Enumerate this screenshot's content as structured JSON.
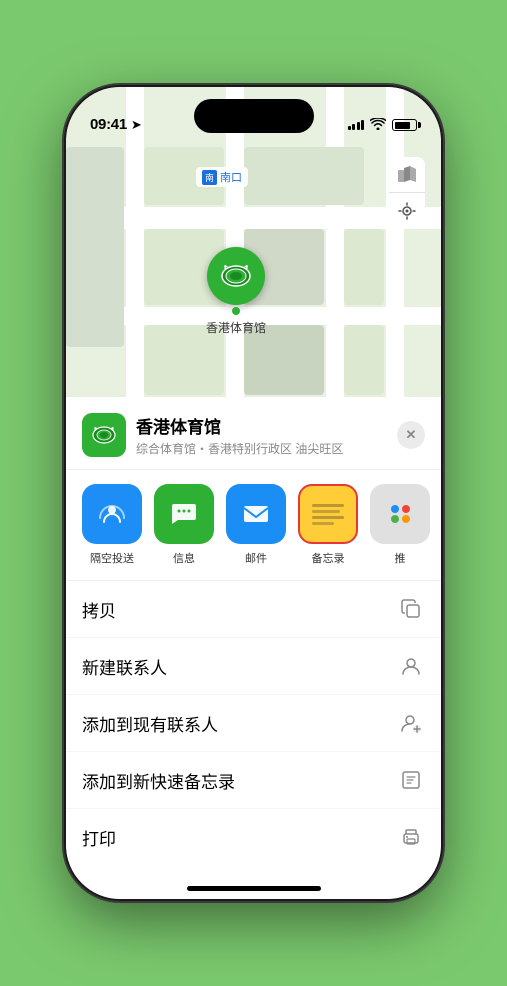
{
  "statusBar": {
    "time": "09:41",
    "location": true
  },
  "map": {
    "label": "南口",
    "controls": {
      "map_icon": "🗺",
      "location_icon": "↗"
    }
  },
  "venueCard": {
    "name": "香港体育馆",
    "subtitle": "综合体育馆・香港特别行政区 油尖旺区",
    "close_label": "✕"
  },
  "shareRow": {
    "items": [
      {
        "id": "airdrop",
        "label": "隔空投送",
        "icon": "📡"
      },
      {
        "id": "messages",
        "label": "信息",
        "icon": "💬"
      },
      {
        "id": "mail",
        "label": "邮件",
        "icon": "✉"
      },
      {
        "id": "notes",
        "label": "备忘录",
        "icon": "notes"
      },
      {
        "id": "more",
        "label": "推",
        "icon": "···"
      }
    ]
  },
  "actionList": [
    {
      "label": "拷贝",
      "icon": "copy"
    },
    {
      "label": "新建联系人",
      "icon": "person"
    },
    {
      "label": "添加到现有联系人",
      "icon": "person-add"
    },
    {
      "label": "添加到新快速备忘录",
      "icon": "note"
    },
    {
      "label": "打印",
      "icon": "print"
    }
  ]
}
